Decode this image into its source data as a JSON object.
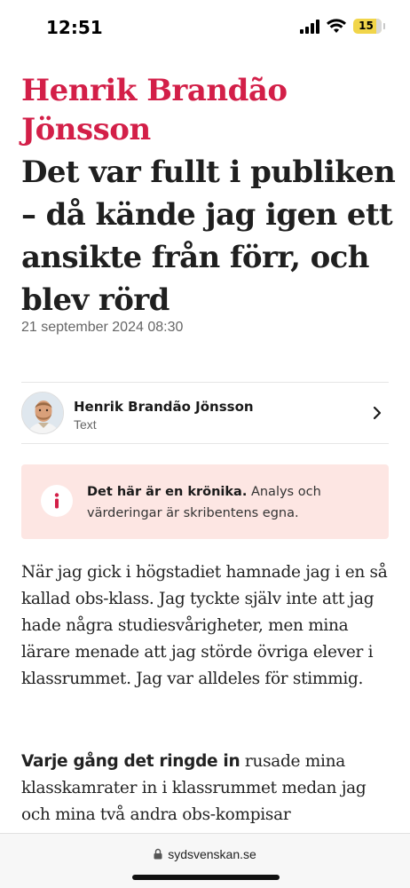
{
  "status_bar": {
    "time": "12:51",
    "battery_level": "15",
    "battery_color": "#f1d54a"
  },
  "article": {
    "author_heading": "Henrik Brandão Jönsson",
    "title": "Det var fullt i publiken – då kände jag igen ett ansikte från förr, och blev rörd",
    "date": "21 september 2024 08:30",
    "accent_color": "#d31f48"
  },
  "byline": {
    "name": "Henrik Brandão Jönsson",
    "role": "Text",
    "avatar_icon": "author-portrait",
    "chevron_icon": "chevron-right-icon"
  },
  "notice": {
    "icon": "info-icon",
    "bold": "Det här är en krönika.",
    "text": " Analys och värderingar är skribentens egna.",
    "background": "#fde6e3"
  },
  "body": {
    "paragraph1": "När jag gick i högstadiet hamnade jag i en så kallad obs-klass. Jag tyckte själv inte att jag hade några studiesvårigheter, men mina lärare menade att jag störde övriga elever i klassrummet. Jag var alldeles för stimmig.",
    "paragraph2_lead": "Varje gång det ringde in",
    "paragraph2_text": " rusade mina klasskamrater in i klassrummet medan jag och mina två andra obs-kompisar"
  },
  "browser": {
    "url": "sydsvenskan.se",
    "lock_icon": "lock-icon"
  }
}
